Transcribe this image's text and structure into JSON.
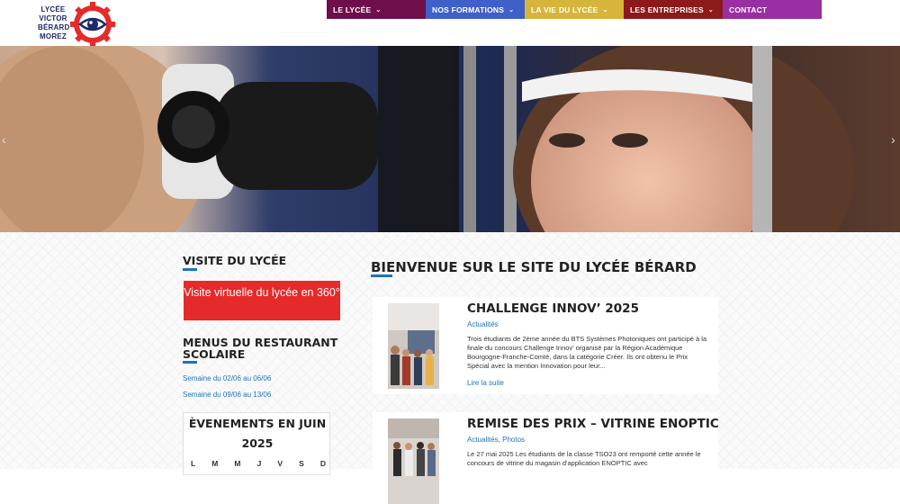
{
  "logo": {
    "lines": [
      "LYCÉE",
      "VICTOR",
      "BÉRARD",
      "MOREZ"
    ]
  },
  "nav": [
    {
      "label": "LE LYCÉE",
      "has_dropdown": true,
      "color": "#6e0f4b"
    },
    {
      "label": "NOS FORMATIONS",
      "has_dropdown": true,
      "color": "#3f5fc9"
    },
    {
      "label": "LA VIE DU LYCÉE",
      "has_dropdown": true,
      "color": "#d6b53a"
    },
    {
      "label": "LES ENTREPRISES",
      "has_dropdown": true,
      "color": "#8c1a1a"
    },
    {
      "label": "CONTACT",
      "has_dropdown": false,
      "color": "#9a2fa3"
    }
  ],
  "sidebar": {
    "visit_title": "VISITE DU LYCÉE",
    "visit_button": "Visite virtuelle du lycée en 360°",
    "menus_title": "MENUS DU RESTAURANT SCOLAIRE",
    "menu_links": [
      "Semaine du 02/06 au 06/06",
      "Semaine du 09/06 au 13/06"
    ],
    "events_title_1": "ÈVENEMENTS EN JUIN",
    "events_title_2": "2025",
    "days": [
      "L",
      "M",
      "M",
      "J",
      "V",
      "S",
      "D"
    ]
  },
  "main": {
    "title": "BIENVENUE SUR LE SITE DU LYCÉE BÉRARD",
    "posts": [
      {
        "title": "CHALLENGE INNOV’ 2025",
        "categories": [
          "Actualités"
        ],
        "excerpt": "Trois étudiants de 2ème année du BTS Systèmes Photoniques ont participé à la finale du concours Challenge Innov’ organisé par la Région Académique Bourgogne-Franche-Comté, dans la catégorie Créer. Ils ont obtenu le Prix Spécial avec la mention Innovation pour leur...",
        "read_more": "Lire la suite"
      },
      {
        "title": "REMISE DES PRIX – VITRINE ENOPTIC",
        "categories": [
          "Actualités",
          "Photos"
        ],
        "excerpt": "Le 27 mai 2025 Les étudiants de la classe TSO23 ont remporté cette année le concours de vitrine du magasin d'application ENOPTIC avec",
        "read_more": ""
      }
    ]
  },
  "colors": {
    "accent": "#1e73be",
    "visit_button": "#e52a2a"
  }
}
